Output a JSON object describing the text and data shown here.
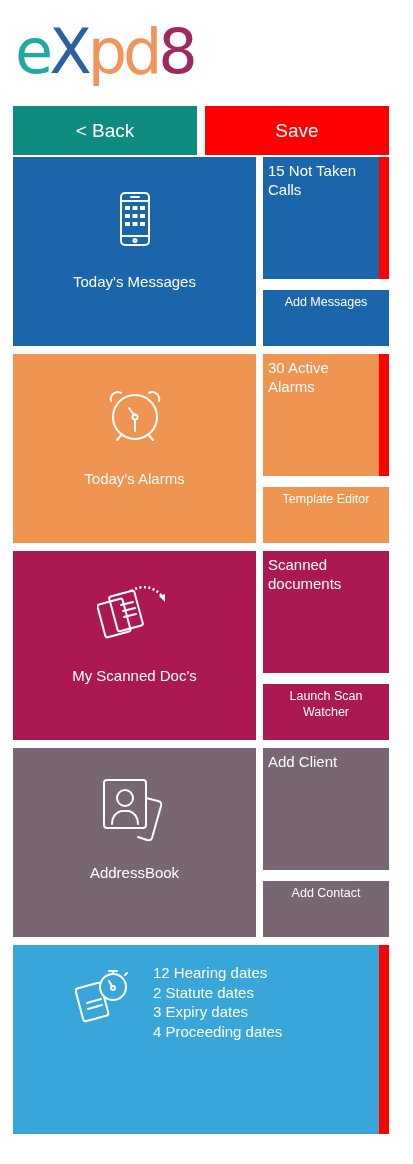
{
  "logo": {
    "parts": [
      {
        "text": "e",
        "color": "#1fa9a0"
      },
      {
        "text": "X",
        "color": "#2d5fa3"
      },
      {
        "text": "pd",
        "color": "#f0965a"
      },
      {
        "text": "8",
        "color": "#9c2a5e"
      }
    ]
  },
  "buttons": [
    {
      "label": "< Back",
      "kind": "back"
    },
    {
      "label": "Save",
      "kind": "save"
    }
  ],
  "groups": [
    {
      "kind": "messages",
      "color": "#1b66aa",
      "title": "Today's Messages",
      "status": {
        "text": "15 Not Taken Calls",
        "alert": true
      },
      "action": "Add Messages"
    },
    {
      "kind": "alarms",
      "color": "#f09452",
      "title": "Today's Alarms",
      "status": {
        "text": "30 Active Alarms",
        "alert": true
      },
      "action": "Template Editor"
    },
    {
      "kind": "documents",
      "color": "#ac1852",
      "title": "My Scanned Doc's",
      "status": {
        "text": "Scanned documents",
        "alert": false
      },
      "action": "Launch Scan Watcher"
    },
    {
      "kind": "contacts",
      "color": "#786673",
      "title": "AddressBook",
      "status": {
        "text": "Add Client",
        "alert": false
      },
      "action": "Add Contact"
    }
  ],
  "summary": {
    "color": "#39a6da",
    "alert": true,
    "lines": [
      "12 Hearing dates",
      "2 Statute dates",
      "3 Expiry dates",
      "4 Proceeding dates"
    ]
  }
}
